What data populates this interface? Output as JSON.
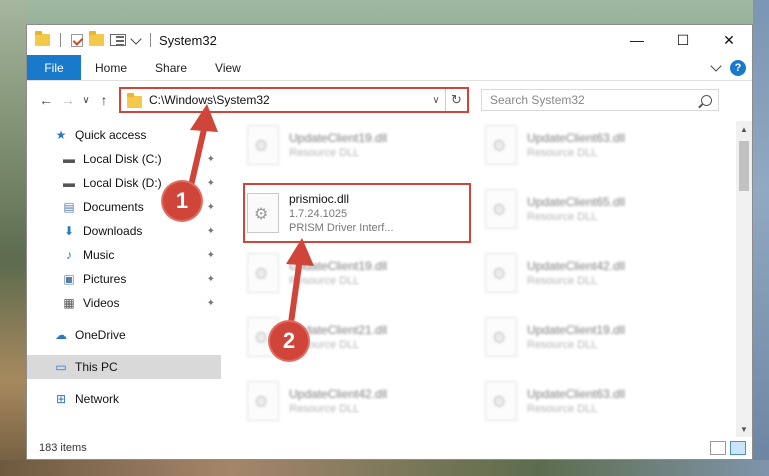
{
  "window": {
    "title": "System32",
    "controls": [
      "—",
      "☐",
      "✕"
    ]
  },
  "ribbon": {
    "file_label": "File",
    "tabs": [
      "Home",
      "Share",
      "View"
    ]
  },
  "address": {
    "path": "C:\\Windows\\System32",
    "dropdown": "∨",
    "refresh": "↻"
  },
  "search": {
    "placeholder": "Search System32"
  },
  "nav": {
    "back": "←",
    "forward": "→",
    "recent": "∨",
    "up": "↑",
    "items": [
      {
        "label": "Quick access",
        "icon": "star-icon",
        "glyph": "★",
        "color": "#2b78c2",
        "level": "top",
        "pinned": false
      },
      {
        "label": "Local Disk (C:)",
        "icon": "disk-icon",
        "glyph": "▬",
        "color": "#555",
        "level": "sub",
        "pinned": true
      },
      {
        "label": "Local Disk (D:)",
        "icon": "disk-icon",
        "glyph": "▬",
        "color": "#555",
        "level": "sub",
        "pinned": true
      },
      {
        "label": "Documents",
        "icon": "document-icon",
        "glyph": "▤",
        "color": "#5a7da8",
        "level": "sub",
        "pinned": true
      },
      {
        "label": "Downloads",
        "icon": "download-icon",
        "glyph": "⬇",
        "color": "#2b78c2",
        "level": "sub",
        "pinned": true
      },
      {
        "label": "Music",
        "icon": "music-icon",
        "glyph": "♪",
        "color": "#2b78c2",
        "level": "sub",
        "pinned": true
      },
      {
        "label": "Pictures",
        "icon": "pictures-icon",
        "glyph": "▣",
        "color": "#5a7da8",
        "level": "sub",
        "pinned": true
      },
      {
        "label": "Videos",
        "icon": "videos-icon",
        "glyph": "▦",
        "color": "#555",
        "level": "sub",
        "pinned": true
      },
      {
        "label": "OneDrive",
        "icon": "cloud-icon",
        "glyph": "☁",
        "color": "#2b78c2",
        "level": "top",
        "pinned": false
      },
      {
        "label": "This PC",
        "icon": "computer-icon",
        "glyph": "▭",
        "color": "#2b78c2",
        "level": "top",
        "pinned": false,
        "selected": true
      },
      {
        "label": "Network",
        "icon": "network-icon",
        "glyph": "⊞",
        "color": "#2b78c2",
        "level": "top",
        "pinned": false
      }
    ]
  },
  "files": [
    {
      "name": "UpdateClient19.dll",
      "desc": "Resource DLL",
      "blurred": true
    },
    {
      "name": "UpdateClient63.dll",
      "desc": "Resource DLL",
      "blurred": true
    },
    {
      "name": "prismioc.dll",
      "version": "1.7.24.1025",
      "desc": "PRISM Driver Interf...",
      "blurred": false
    },
    {
      "name": "UpdateClient65.dll",
      "desc": "Resource DLL",
      "blurred": true
    },
    {
      "name": "UpdateClient19.dll",
      "desc": "Resource DLL",
      "blurred": true
    },
    {
      "name": "UpdateClient42.dll",
      "desc": "Resource DLL",
      "blurred": true
    },
    {
      "name": "UpdateClient21.dll",
      "desc": "Resource DLL",
      "blurred": true
    },
    {
      "name": "UpdateClient19.dll",
      "desc": "Resource DLL",
      "blurred": true
    },
    {
      "name": "UpdateClient42.dll",
      "desc": "Resource DLL",
      "blurred": true
    },
    {
      "name": "UpdateClient63.dll",
      "desc": "Resource DLL",
      "blurred": true
    }
  ],
  "status": {
    "count": "183 items"
  },
  "annotations": {
    "step1": "1",
    "step2": "2",
    "color": "#d0453a"
  }
}
